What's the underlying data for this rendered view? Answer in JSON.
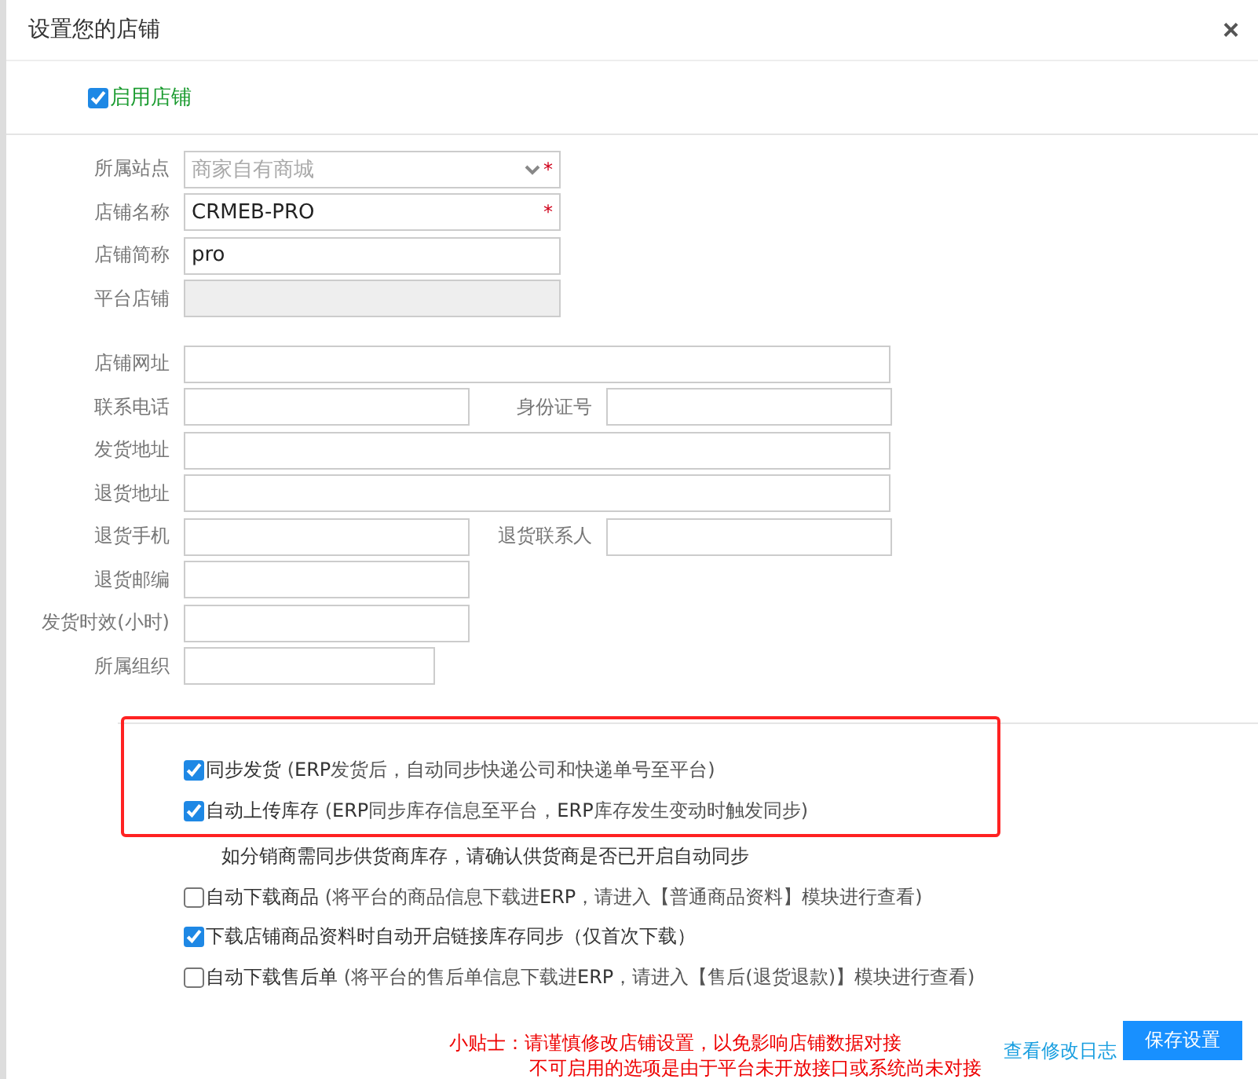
{
  "window": {
    "title": "设置您的店铺",
    "close": "×"
  },
  "enable": {
    "label": "启用店铺",
    "checked": true
  },
  "basic_fields": [
    {
      "label": "所属站点",
      "kind": "select",
      "value": "商家自有商城",
      "required_mark": "*",
      "disabled": false
    },
    {
      "label": "店铺名称",
      "kind": "text",
      "value": "CRMEB-PRO",
      "required_mark": "*",
      "disabled": false
    },
    {
      "label": "店铺简称",
      "kind": "text",
      "value": "pro",
      "disabled": false
    },
    {
      "label": "平台店铺",
      "kind": "text",
      "disabled": true
    }
  ],
  "contact_rows": [
    [
      {
        "label": "店铺网址",
        "kind": "full"
      }
    ],
    [
      {
        "label": "联系电话",
        "kind": "half"
      },
      {
        "label": "身份证号",
        "kind": "half"
      }
    ],
    [
      {
        "label": "发货地址",
        "kind": "full"
      }
    ],
    [
      {
        "label": "退货地址",
        "kind": "full"
      }
    ],
    [
      {
        "label": "退货手机",
        "kind": "half"
      },
      {
        "label": "退货联系人",
        "kind": "half"
      }
    ],
    [
      {
        "label": "退货邮编",
        "kind": "half"
      }
    ],
    [
      {
        "label": "发货时效(小时)",
        "kind": "half"
      }
    ],
    [
      {
        "label": "所属组织",
        "kind": "short"
      }
    ]
  ],
  "highlighted_options": [
    {
      "kind": "checkbox",
      "checked": true,
      "label": "同步发货",
      "hint": [
        {
          "text": " (",
          "kind": "plain"
        },
        {
          "text": "ERP",
          "kind": "accent"
        },
        {
          "text": "发货后，自动同步快递公司和快递单号至平台)",
          "kind": "plain"
        }
      ]
    },
    {
      "kind": "checkbox",
      "checked": true,
      "label": "自动上传库存",
      "hint": [
        {
          "text": " (",
          "kind": "plain"
        },
        {
          "text": "ERP",
          "kind": "accent"
        },
        {
          "text": "同步库存信息至平台，",
          "kind": "plain"
        },
        {
          "text": "ERP",
          "kind": "accent"
        },
        {
          "text": "库存发生变动时触发同步)",
          "kind": "plain"
        }
      ]
    }
  ],
  "other_options": [
    {
      "kind": "note",
      "label": "如分销商需同步供货商库存，请确认供货商是否已开启自动同步"
    },
    {
      "kind": "checkbox",
      "checked": false,
      "label": "自动下载商品",
      "hint": [
        {
          "text": " (将平台的商品信息下载进",
          "kind": "plain"
        },
        {
          "text": "ERP",
          "kind": "accent"
        },
        {
          "text": "，请进入【普通商品资料】模块进行查看)",
          "kind": "plain"
        }
      ]
    },
    {
      "kind": "checkbox",
      "checked": true,
      "label": "下载店铺商品资料时自动开启链接库存同步（仅首次下载）"
    },
    {
      "kind": "checkbox",
      "checked": false,
      "label": "自动下载售后单",
      "hint": [
        {
          "text": " (将平台的售后单信息下载进",
          "kind": "plain"
        },
        {
          "text": "ERP",
          "kind": "accent"
        },
        {
          "text": "，请进入【售后(退货退款)】模块进行查看)",
          "kind": "plain"
        }
      ]
    }
  ],
  "footer": {
    "tips": [
      "小贴士：请谨慎修改店铺设置，以免影响店铺数据对接",
      "不可启用的选项是由于平台未开放接口或系统尚未对接"
    ],
    "log_link": "查看修改日志",
    "save_button": "保存设置"
  }
}
